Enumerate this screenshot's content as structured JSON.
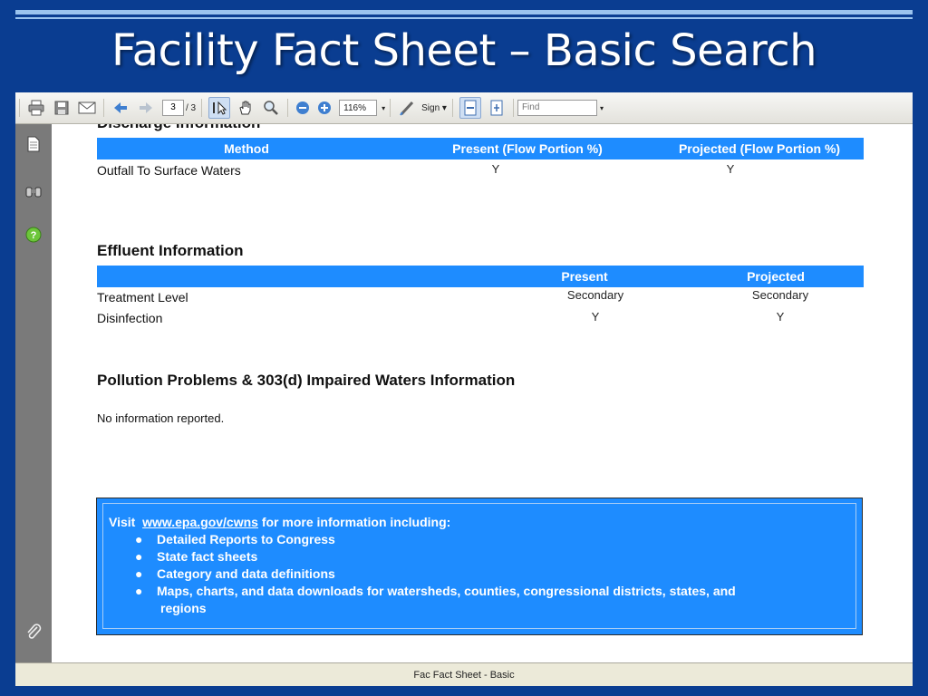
{
  "slide": {
    "title": "Facility Fact Sheet – Basic Search"
  },
  "toolbar": {
    "page_current": "3",
    "page_total": "/ 3",
    "zoom": "116%",
    "sign_label": "Sign",
    "find_placeholder": "Find",
    "icons": [
      "print-icon",
      "save-icon",
      "email-icon",
      "prev-page-icon",
      "next-page-icon",
      "select-tool-icon",
      "hand-tool-icon",
      "zoom-tool-icon",
      "zoom-out-icon",
      "zoom-in-icon",
      "sign-pen-icon",
      "fit-page-icon",
      "full-screen-icon"
    ]
  },
  "sidebar": {
    "icons": [
      "pages-icon",
      "binoculars-icon",
      "help-icon",
      "attachment-icon"
    ]
  },
  "document": {
    "discharge": {
      "title": "Discharge Information",
      "headers": [
        "Method",
        "Present (Flow Portion %)",
        "Projected (Flow Portion %)"
      ],
      "rows": [
        {
          "label": "Outfall To Surface Waters",
          "present": "Y",
          "projected": "Y"
        }
      ]
    },
    "effluent": {
      "title": "Effluent Information",
      "headers": [
        "",
        "Present",
        "Projected"
      ],
      "rows": [
        {
          "label": "Treatment Level",
          "present": "Secondary",
          "projected": "Secondary"
        },
        {
          "label": "Disinfection",
          "present": "Y",
          "projected": "Y"
        }
      ]
    },
    "pollution": {
      "title": "Pollution Problems & 303(d) Impaired Waters Information",
      "message": "No information reported."
    },
    "info_box": {
      "visit": "Visit",
      "link": "www.epa.gov/cwns",
      "suffix": "for more information including:",
      "bullets": [
        "Detailed Reports to Congress",
        "State fact sheets",
        "Category and data definitions",
        "Maps, charts, and data downloads for watersheds, counties, congressional districts, states, and",
        "regions"
      ]
    }
  },
  "statusbar": {
    "text": "Fac Fact Sheet - Basic"
  },
  "colors": {
    "slide_bg": "#0a3d91",
    "table_header": "#1e8cff",
    "sidebar": "#7a7a7a"
  }
}
